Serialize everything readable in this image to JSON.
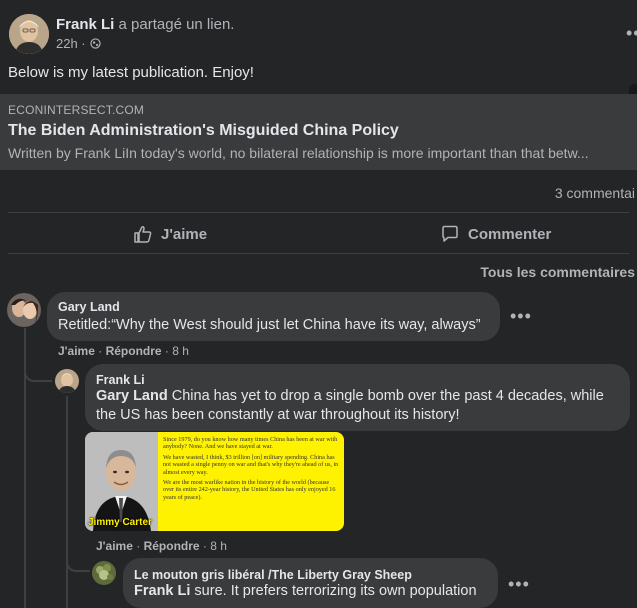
{
  "post": {
    "author": "Frank Li",
    "action": " a partagé un lien.",
    "time": "22h · ",
    "text": "Below is my latest publication. Enjoy!"
  },
  "link": {
    "domain": "ECONINTERSECT.COM",
    "title": "The Biden Administration's Misguided China Policy",
    "description": "Written by Frank LiIn today's world, no bilateral relationship is more important than that betw..."
  },
  "stats": {
    "comments": "3 commentai"
  },
  "actions": {
    "like": "J'aime",
    "comment": "Commenter"
  },
  "filter": {
    "label": "Tous les commentaires"
  },
  "comments": [
    {
      "author": "Gary Land",
      "text": "Retitled:“Why the West should just let China have its way, always”",
      "like": "J'aime",
      "reply": "Répondre",
      "time": "8 h"
    },
    {
      "author": "Frank Li",
      "mention": "Gary Land",
      "text": " China has yet to drop a single bomb over the past 4 decades, while the US has been constantly at war throughout its history!",
      "like": "J'aime",
      "reply": "Répondre",
      "time": "8 h",
      "image": {
        "caption": "Jimmy Carter",
        "p1": "Since 1979, do you know how many times China has been at war with anybody? None. And we have stayed at war.",
        "p2": "We have wasted, I think, $3 trillion [on] military spending. China has not wasted a single penny on war and that's why they're ahead of us, in almost every way.",
        "p3": "We are the most warlike nation in the history of the world (because over its entire 242-year history, the United States has only enjoyed 16 years of peace)."
      }
    },
    {
      "author": "Le mouton gris libéral /The Liberty Gray Sheep",
      "mention": "Frank Li",
      "text": " sure. It prefers terrorizing its own population"
    }
  ],
  "colors": {
    "card": "#242526",
    "bubble": "#3a3b3c",
    "primary_text": "#e4e6eb",
    "secondary_text": "#b0b3b8",
    "quote_bg": "#fff200"
  },
  "icons": [
    "globe-icon",
    "thumbs-up-icon",
    "comment-icon",
    "more-options-icon"
  ]
}
